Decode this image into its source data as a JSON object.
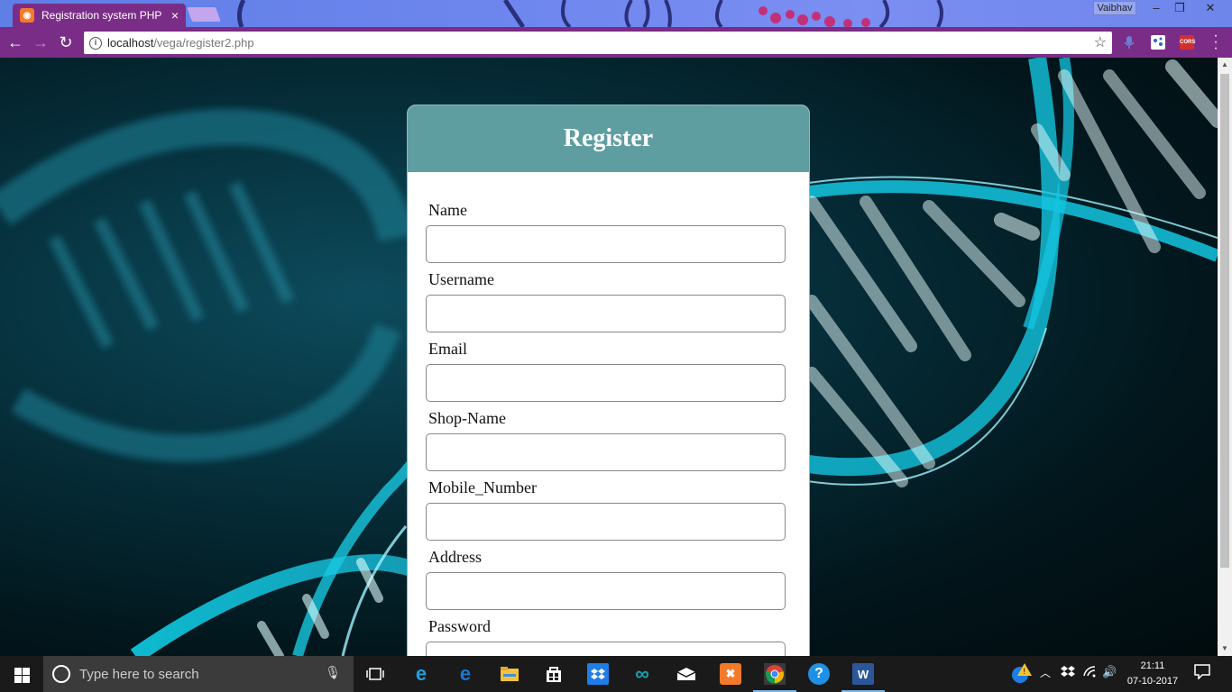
{
  "browser": {
    "tab_title": "Registration system PHP",
    "tab_close": "×",
    "profile_name": "Vaibhav",
    "url_host": "localhost",
    "url_path": "/vega/register2.php",
    "window_minimize": "–",
    "window_restore": "❐",
    "window_close": "✕",
    "extension_cors_label": "CORS"
  },
  "form": {
    "title": "Register",
    "fields": [
      {
        "label": "Name",
        "value": ""
      },
      {
        "label": "Username",
        "value": ""
      },
      {
        "label": "Email",
        "value": ""
      },
      {
        "label": "Shop-Name",
        "value": ""
      },
      {
        "label": "Mobile_Number",
        "value": ""
      },
      {
        "label": "Address",
        "value": ""
      },
      {
        "label": "Password",
        "value": ""
      }
    ]
  },
  "taskbar": {
    "search_placeholder": "Type here to search",
    "time": "21:11",
    "date": "07-10-2017",
    "pinned_icons": [
      "task-view-icon",
      "internet-explorer-icon",
      "edge-icon",
      "file-explorer-icon",
      "store-icon",
      "dropbox-icon",
      "arduino-icon",
      "mail-icon",
      "xampp-icon",
      "chrome-icon",
      "help-icon",
      "word-icon"
    ]
  },
  "colors": {
    "form_header": "#5f9ea0",
    "browser_toolbar": "#7a2d86",
    "taskbar": "#1a1a1a"
  }
}
